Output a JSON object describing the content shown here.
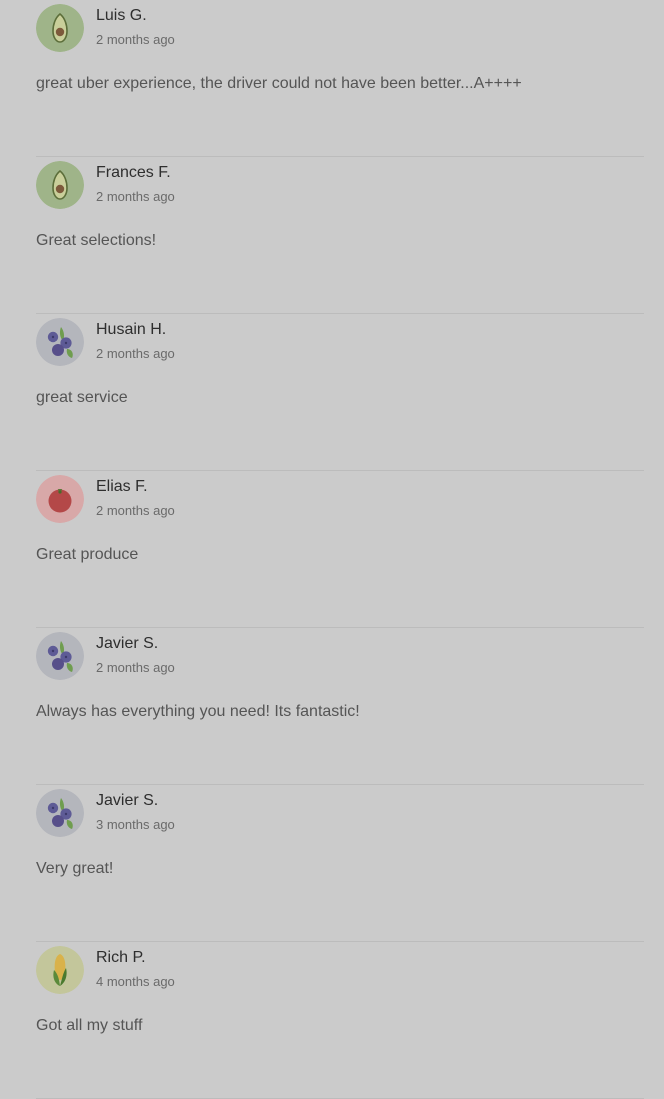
{
  "reviews": [
    {
      "name": "Luis G.",
      "time": "2 months ago",
      "text": "great uber experience, the driver could not have been better...A++++",
      "avatar": "avocado-icon"
    },
    {
      "name": "Frances F.",
      "time": "2 months ago",
      "text": "Great selections!",
      "avatar": "avocado-icon"
    },
    {
      "name": "Husain H.",
      "time": "2 months ago",
      "text": "great service",
      "avatar": "blueberry-icon"
    },
    {
      "name": "Elias F.",
      "time": "2 months ago",
      "text": "Great produce",
      "avatar": "tomato-icon"
    },
    {
      "name": "Javier S.",
      "time": "2 months ago",
      "text": "Always has everything you need! Its fantastic!",
      "avatar": "blueberry-icon"
    },
    {
      "name": "Javier S.",
      "time": "3 months ago",
      "text": "Very great!",
      "avatar": "blueberry-icon"
    },
    {
      "name": "Rich P.",
      "time": "4 months ago",
      "text": "Got all my stuff",
      "avatar": "corn-icon"
    }
  ]
}
